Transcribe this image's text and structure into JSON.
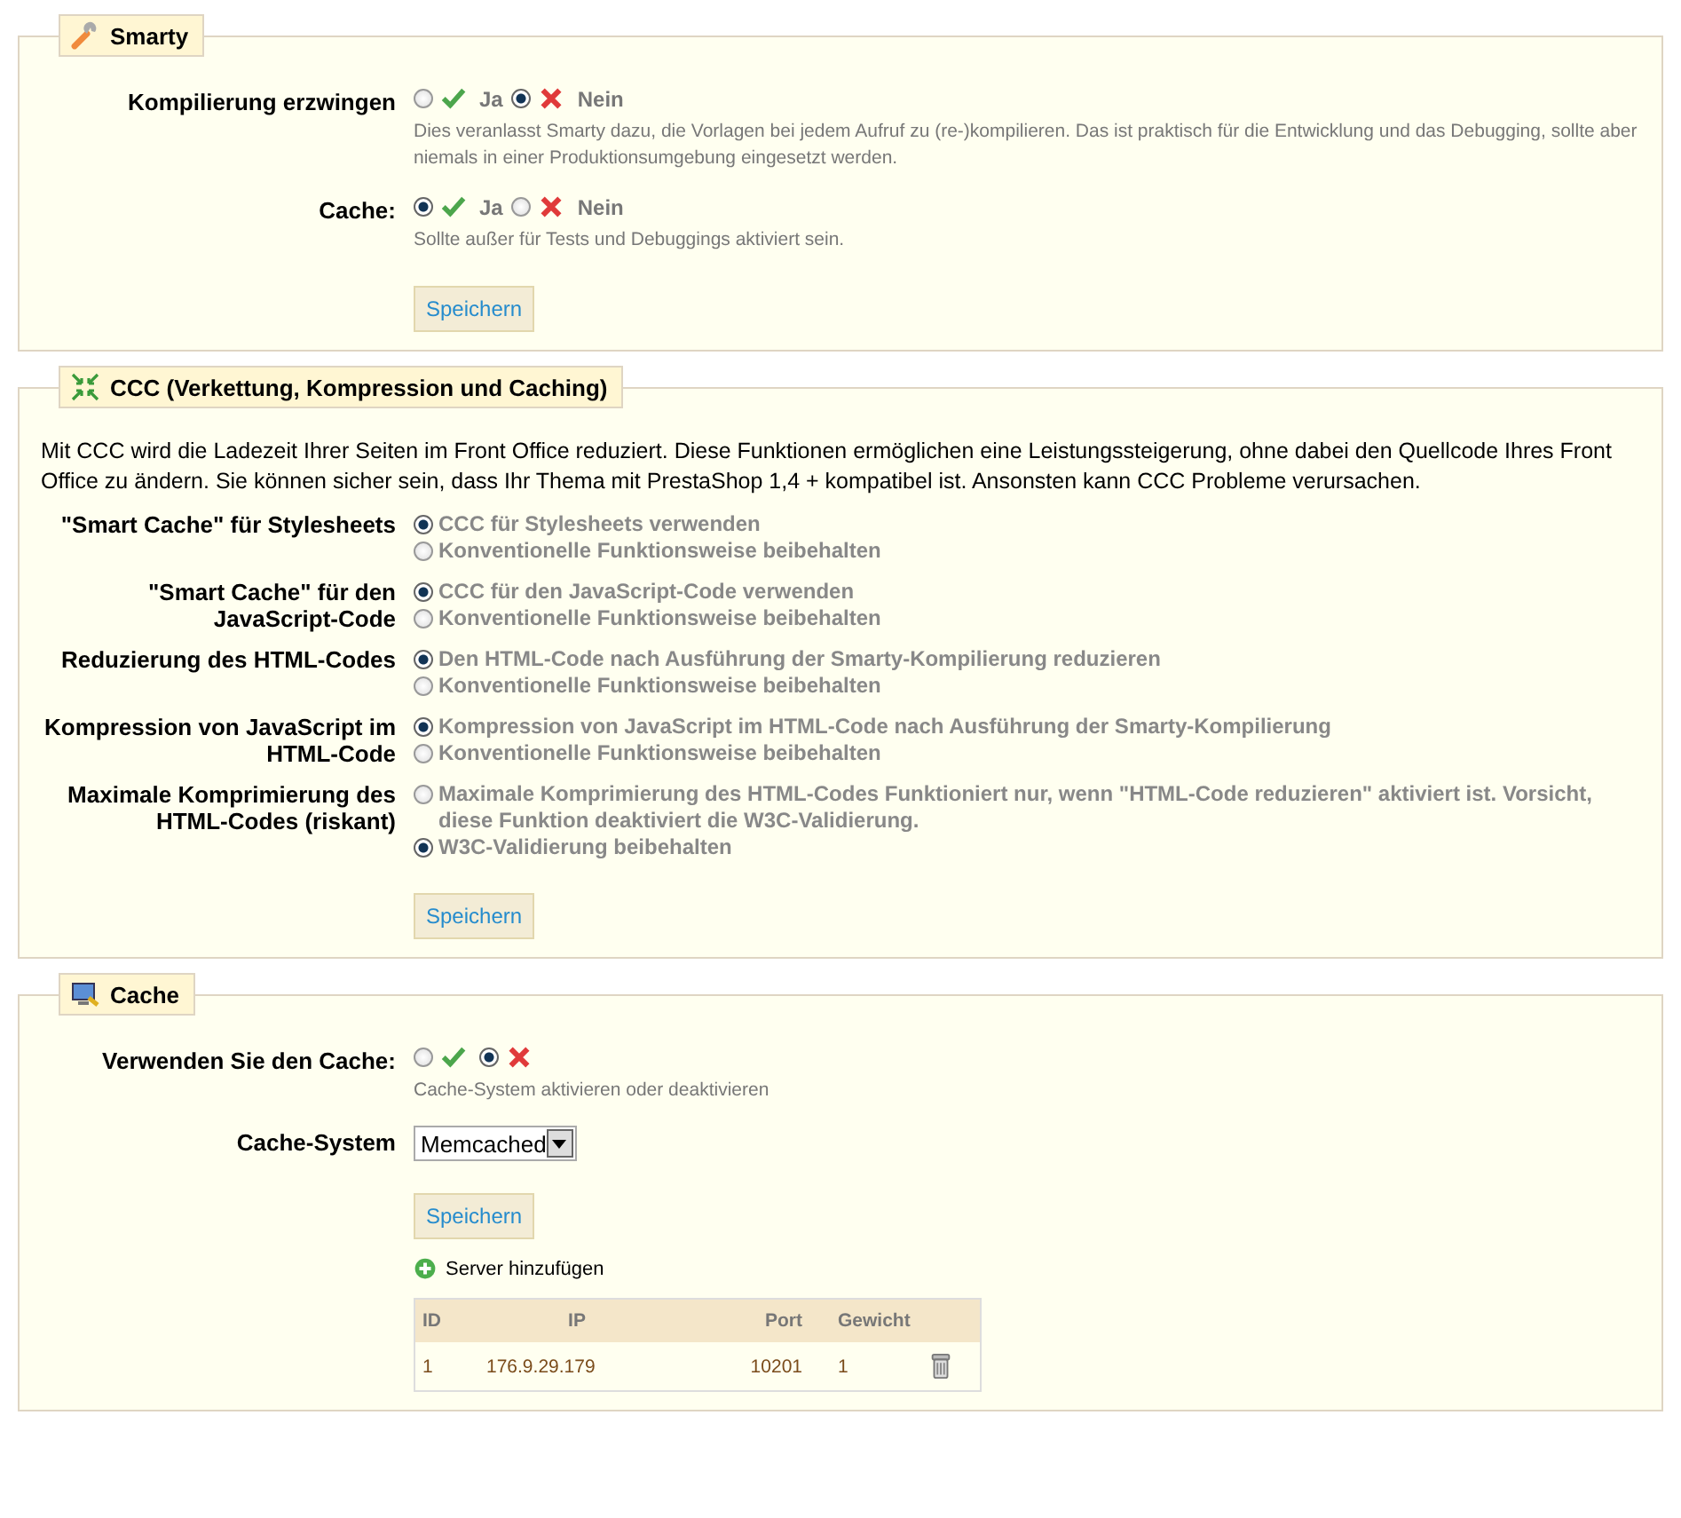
{
  "sections": [
    {
      "title": "Smarty",
      "fields": [
        {
          "kind": "yesno",
          "label": "Kompilierung erzwingen",
          "options": [
            {
              "kind": "yes",
              "label": "Ja",
              "selected": false
            },
            {
              "kind": "no",
              "label": "Nein",
              "selected": true
            }
          ],
          "hint": "Dies veranlasst Smarty dazu, die Vorlagen bei jedem Aufruf zu (re-)kompilieren. Das ist praktisch für die Entwicklung und das Debugging, sollte aber niemals in einer Produktionsumgebung eingesetzt werden."
        },
        {
          "kind": "yesno",
          "label": "Cache:",
          "options": [
            {
              "kind": "yes",
              "label": "Ja",
              "selected": true
            },
            {
              "kind": "no",
              "label": "Nein",
              "selected": false
            }
          ],
          "hint": "Sollte außer für Tests und Debuggings aktiviert sein."
        }
      ],
      "button": "Speichern"
    },
    {
      "title": "CCC (Verkettung, Kompression und Caching)",
      "intro": "Mit CCC wird die Ladezeit Ihrer Seiten im Front Office reduziert. Diese Funktionen ermöglichen eine Leistungssteigerung, ohne dabei den Quellcode Ihres Front Office zu ändern. Sie können sicher sein, dass Ihr Thema mit PrestaShop 1,4 + kompatibel ist. Ansonsten kann CCC Probleme verursachen.",
      "fields": [
        {
          "kind": "choices",
          "label": "\"Smart Cache\" für Stylesheets",
          "options": [
            {
              "label": "CCC für Stylesheets verwenden",
              "selected": true
            },
            {
              "label": "Konventionelle Funktionsweise beibehalten",
              "selected": false
            }
          ]
        },
        {
          "kind": "choices",
          "label": "\"Smart Cache\" für den JavaScript-Code",
          "options": [
            {
              "label": "CCC für den JavaScript-Code verwenden",
              "selected": true
            },
            {
              "label": "Konventionelle Funktionsweise beibehalten",
              "selected": false
            }
          ]
        },
        {
          "kind": "choices",
          "label": "Reduzierung des HTML-Codes",
          "options": [
            {
              "label": "Den HTML-Code nach Ausführung der Smarty-Kompilierung reduzieren",
              "selected": true
            },
            {
              "label": "Konventionelle Funktionsweise beibehalten",
              "selected": false
            }
          ]
        },
        {
          "kind": "choices",
          "label": "Kompression von JavaScript im HTML-Code",
          "options": [
            {
              "label": "Kompression von JavaScript im HTML-Code nach Ausführung der Smarty-Kompilierung",
              "selected": true
            },
            {
              "label": "Konventionelle Funktionsweise beibehalten",
              "selected": false
            }
          ]
        },
        {
          "kind": "choices",
          "label": "Maximale Komprimierung des HTML-Codes (riskant)",
          "options": [
            {
              "label": "Maximale Komprimierung des HTML-Codes Funktioniert nur, wenn \"HTML-Code reduzieren\" aktiviert ist. Vorsicht, diese Funktion deaktiviert die W3C-Validierung.",
              "selected": false
            },
            {
              "label": "W3C-Validierung beibehalten",
              "selected": true
            }
          ]
        }
      ],
      "button": "Speichern"
    },
    {
      "title": "Cache",
      "fields": [
        {
          "kind": "yesno",
          "label": "Verwenden Sie den Cache:",
          "options": [
            {
              "kind": "yes",
              "selected": false
            },
            {
              "kind": "no",
              "selected": true
            }
          ],
          "hint": "Cache-System aktivieren oder deaktivieren"
        },
        {
          "kind": "select",
          "label": "Cache-System",
          "value": "Memcached"
        }
      ],
      "button": "Speichern",
      "add_link": "Server hinzufügen",
      "table": {
        "columns": [
          "ID",
          "IP",
          "Port",
          "Gewicht"
        ],
        "rows": [
          [
            "1",
            "176.9.29.179",
            "10201",
            "1"
          ]
        ]
      }
    }
  ]
}
